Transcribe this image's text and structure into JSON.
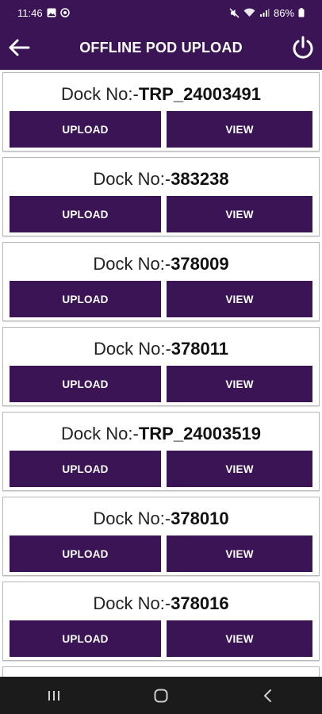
{
  "status_bar": {
    "time": "11:46",
    "battery": "86%"
  },
  "app_bar": {
    "title": "OFFLINE POD UPLOAD",
    "back_icon": "arrow-left-icon",
    "power_icon": "power-icon"
  },
  "dock_prefix": "Dock No:-",
  "buttons": {
    "upload": "UPLOAD",
    "view": "VIEW"
  },
  "items": [
    {
      "dock_no": "TRP_24003491"
    },
    {
      "dock_no": "383238"
    },
    {
      "dock_no": "378009"
    },
    {
      "dock_no": "378011"
    },
    {
      "dock_no": "TRP_24003519"
    },
    {
      "dock_no": "378010"
    },
    {
      "dock_no": "378016"
    }
  ],
  "colors": {
    "primary": "#3a1454",
    "nav_bar": "#1b1b1b"
  }
}
